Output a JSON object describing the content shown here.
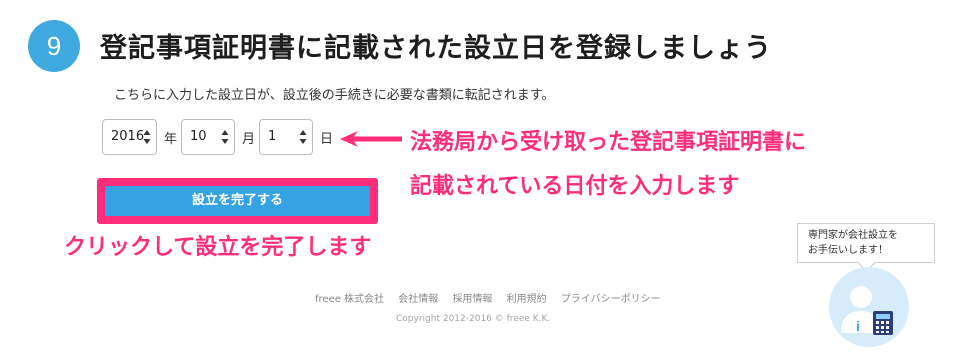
{
  "step": {
    "number": "9",
    "title": "登記事項証明書に記載された設立日を登録しましょう",
    "description": "こちらに入力した設立日が、設立後の手続きに必要な書類に転記されます。"
  },
  "date_form": {
    "year": {
      "value": "2016",
      "unit": "年"
    },
    "month": {
      "value": "10",
      "unit": "月"
    },
    "day": {
      "value": "1",
      "unit": "日"
    }
  },
  "annotations": {
    "date_note_line1": "法務局から受け取った登記事項証明書に",
    "date_note_line2": "記載されている日付を入力します",
    "submit_note": "クリックして設立を完了します",
    "accent_color": "#ff2d7a"
  },
  "submit": {
    "label": "設立を完了する",
    "color": "#35a2e3"
  },
  "footer": {
    "links": [
      "freee 株式会社",
      "会社情報",
      "採用情報",
      "利用規約",
      "プライバシーポリシー"
    ],
    "copyright": "Copyright 2012-2016 © freee K.K."
  },
  "help": {
    "line1": "専門家が会社設立を",
    "line2": "お手伝いします！",
    "icon": "consultant-calculator-icon"
  }
}
